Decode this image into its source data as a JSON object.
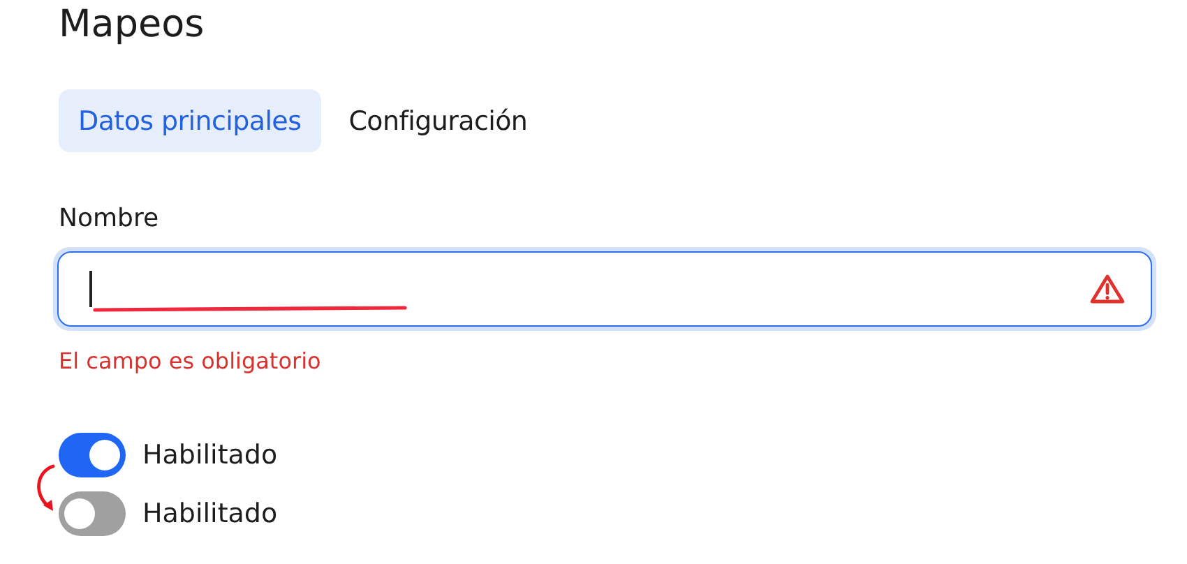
{
  "page": {
    "title": "Mapeos"
  },
  "tabs": [
    {
      "label": "Datos principales",
      "selected": true
    },
    {
      "label": "Configuración",
      "selected": false
    }
  ],
  "field": {
    "label": "Nombre",
    "focused": true,
    "error": "El campo es obligatorio"
  },
  "toggles": [
    {
      "label": "Habilitado",
      "on": true
    },
    {
      "label": "Habilitado",
      "on": false
    }
  ]
}
